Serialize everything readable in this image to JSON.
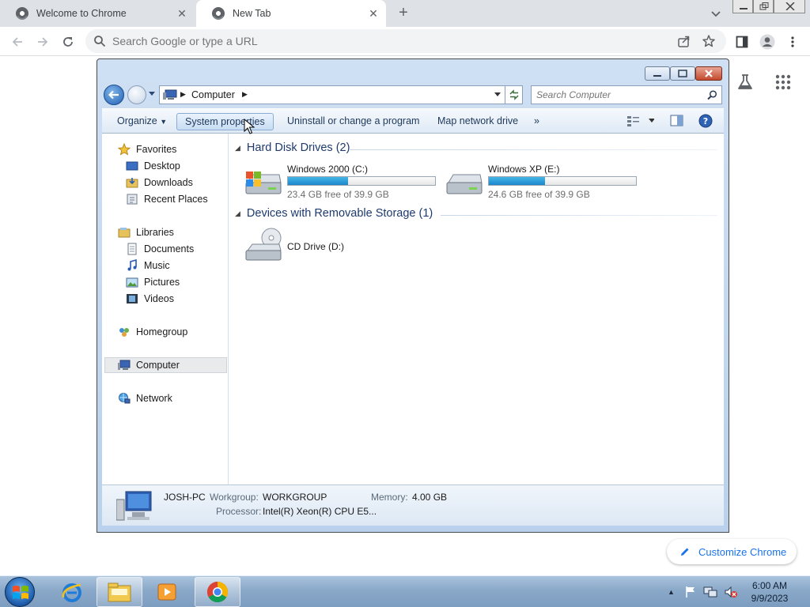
{
  "browser": {
    "tabs": [
      {
        "title": "Welcome to Chrome",
        "active": false
      },
      {
        "title": "New Tab",
        "active": true
      }
    ],
    "omnibox_placeholder": "Search Google or type a URL",
    "customize_label": "Customize Chrome"
  },
  "explorer": {
    "breadcrumb": "Computer",
    "search_placeholder": "Search Computer",
    "commands": {
      "organize": "Organize",
      "system_properties": "System properties",
      "uninstall": "Uninstall or change a program",
      "map_drive": "Map network drive",
      "more": "»"
    },
    "nav": {
      "favorites": "Favorites",
      "desktop": "Desktop",
      "downloads": "Downloads",
      "recent": "Recent Places",
      "libraries": "Libraries",
      "documents": "Documents",
      "music": "Music",
      "pictures": "Pictures",
      "videos": "Videos",
      "homegroup": "Homegroup",
      "computer": "Computer",
      "network": "Network"
    },
    "groups": {
      "hdd": "Hard Disk Drives (2)",
      "removable": "Devices with Removable Storage (1)"
    },
    "drives": [
      {
        "name": "Windows 2000 (C:)",
        "free": "23.4 GB free of 39.9 GB",
        "used_fraction": 0.41
      },
      {
        "name": "Windows XP (E:)",
        "free": "24.6 GB free of 39.9 GB",
        "used_fraction": 0.38
      }
    ],
    "cd": {
      "name": "CD Drive (D:)"
    },
    "details": {
      "pc_name": "JOSH-PC",
      "workgroup_label": "Workgroup:",
      "workgroup": "WORKGROUP",
      "memory_label": "Memory:",
      "memory": "4.00 GB",
      "processor_label": "Processor:",
      "processor": "Intel(R) Xeon(R) CPU E5..."
    }
  },
  "taskbar": {
    "time": "6:00 AM",
    "date": "9/9/2023"
  },
  "colors": {
    "chrome_tabstrip": "#dee1e6",
    "link_blue": "#1a73e8",
    "explorer_frame": "#b9d1ec",
    "drive_bar": "#26a0da",
    "group_header": "#1e3a6e"
  }
}
